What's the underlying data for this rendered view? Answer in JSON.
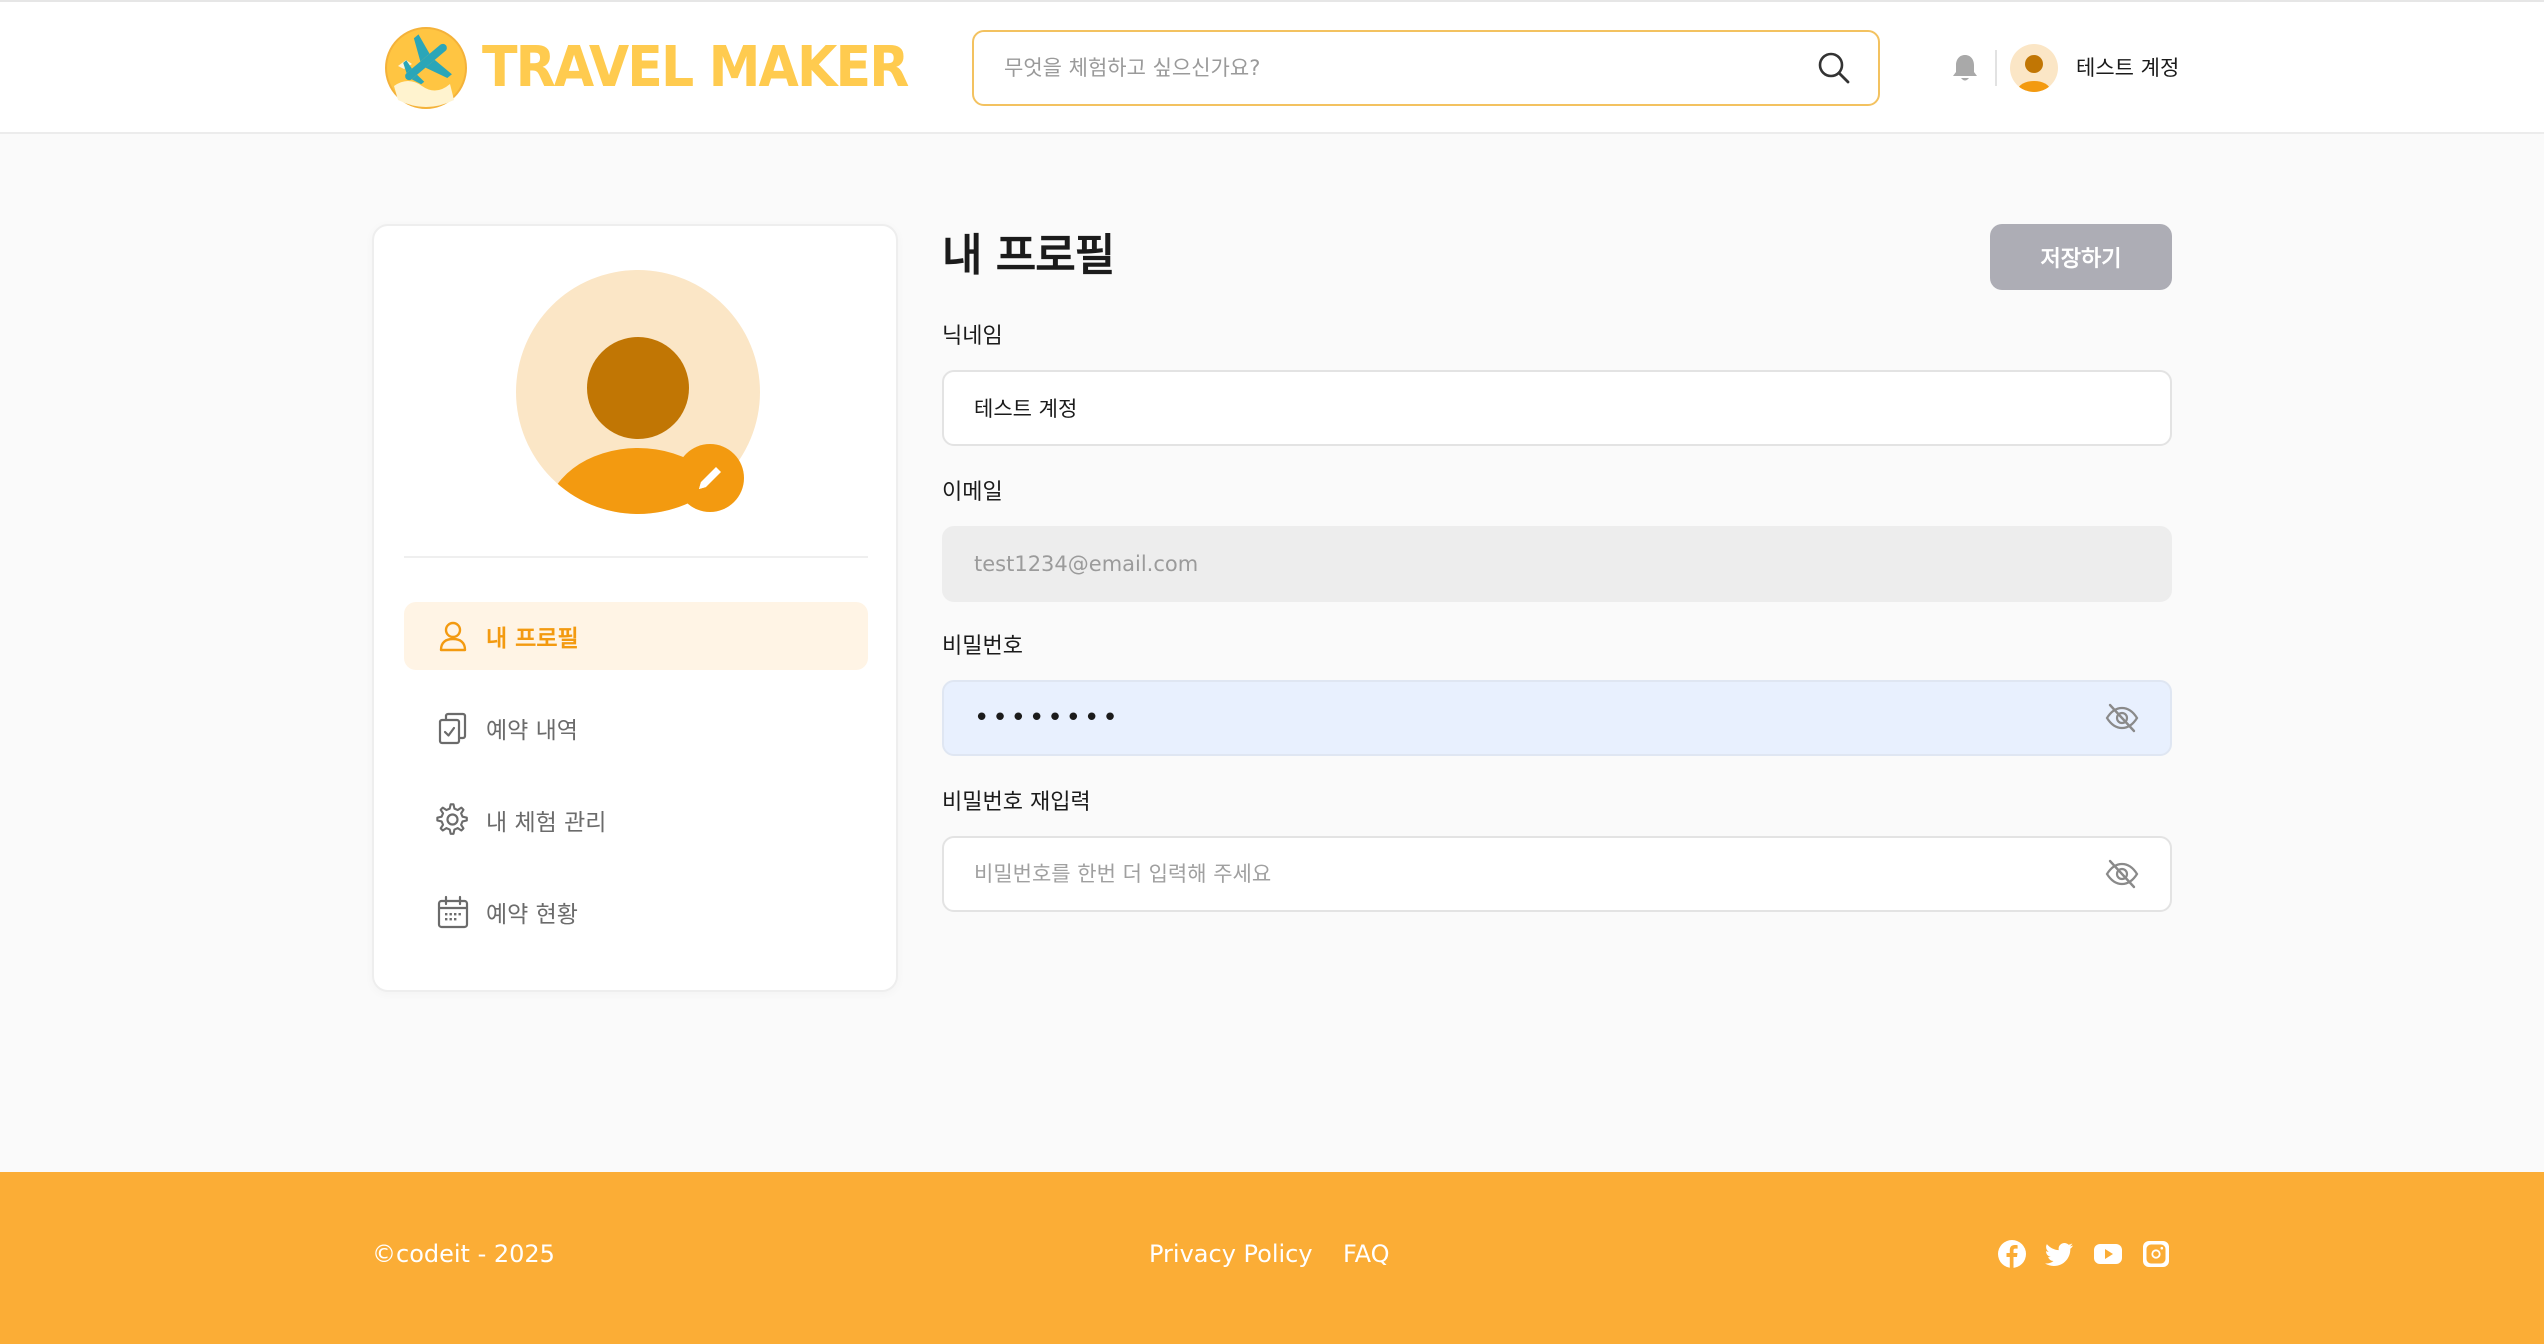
{
  "header": {
    "logo_text": "TRAVEL MAKER",
    "search_placeholder": "무엇을 체험하고 싶으신가요?",
    "user_name": "테스트 계정",
    "icons": [
      "logo-icon",
      "search-icon",
      "bell-icon",
      "avatar"
    ]
  },
  "sidebar": {
    "menu": [
      {
        "label": "내 프로필",
        "icon": "user-icon",
        "active": true
      },
      {
        "label": "예약 내역",
        "icon": "clipboard-check-icon",
        "active": false
      },
      {
        "label": "내 체험 관리",
        "icon": "gear-icon",
        "active": false
      },
      {
        "label": "예약 현황",
        "icon": "calendar-icon",
        "active": false
      }
    ]
  },
  "main": {
    "title": "내 프로필",
    "save_label": "저장하기",
    "nickname": {
      "label": "닉네임",
      "value": "테스트 계정"
    },
    "email": {
      "label": "이메일",
      "value": "test1234@email.com"
    },
    "password": {
      "label": "비밀번호",
      "value": "••••••••"
    },
    "password_confirm": {
      "label": "비밀번호 재입력",
      "placeholder": "비밀번호를 한번 더 입력해 주세요"
    }
  },
  "footer": {
    "copyright": "©codeit - 2025",
    "links": [
      "Privacy Policy",
      "FAQ"
    ],
    "social": [
      "facebook-icon",
      "twitter-icon",
      "youtube-icon",
      "instagram-icon"
    ]
  },
  "colors": {
    "brand": "#ffcb4f",
    "accent": "#f39a10",
    "footer": "#fbad36",
    "save_disabled": "#adadb5"
  }
}
